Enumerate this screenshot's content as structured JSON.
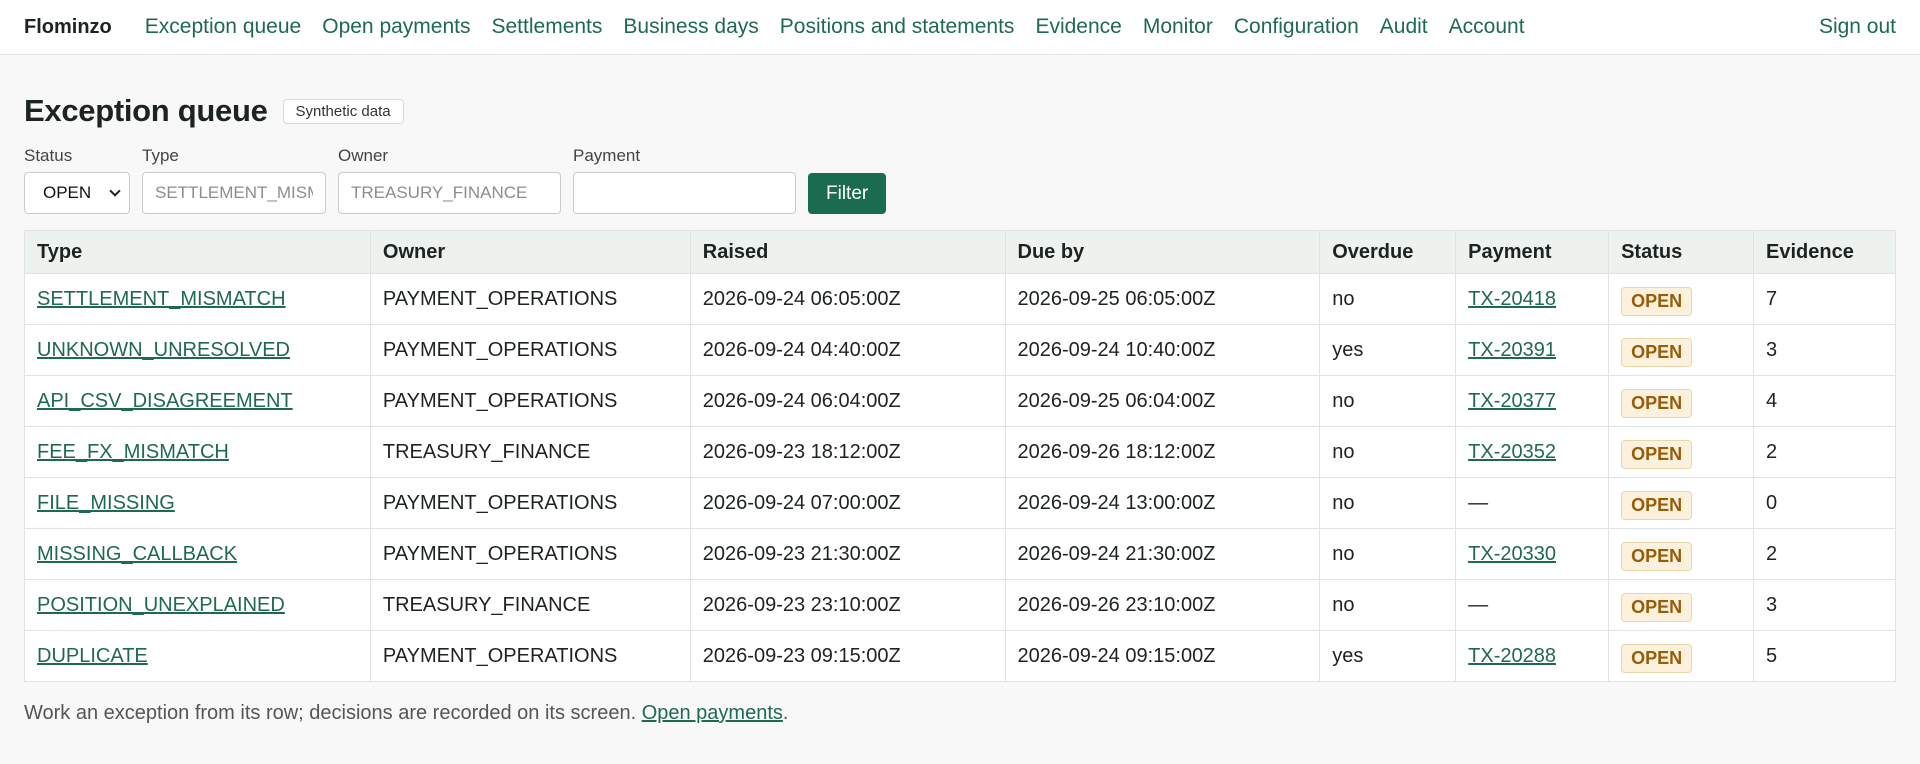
{
  "nav": {
    "brand": "Flominzo",
    "links": [
      "Exception queue",
      "Open payments",
      "Settlements",
      "Business days",
      "Positions and statements",
      "Evidence",
      "Monitor",
      "Configuration",
      "Audit",
      "Account"
    ],
    "sign_out": "Sign out"
  },
  "page": {
    "title": "Exception queue",
    "badge": "Synthetic data"
  },
  "filters": {
    "status_label": "Status",
    "status_value": "OPEN",
    "type_label": "Type",
    "type_placeholder": "SETTLEMENT_MISMATCH",
    "owner_label": "Owner",
    "owner_placeholder": "TREASURY_FINANCE",
    "payment_label": "Payment",
    "payment_placeholder": "",
    "filter_button": "Filter"
  },
  "table": {
    "headers": [
      "Type",
      "Owner",
      "Raised",
      "Due by",
      "Overdue",
      "Payment",
      "Status",
      "Evidence"
    ],
    "rows": [
      {
        "type": "SETTLEMENT_MISMATCH",
        "owner": "PAYMENT_OPERATIONS",
        "raised": "2026-09-24 06:05:00Z",
        "due": "2026-09-25 06:05:00Z",
        "overdue": "no",
        "payment": "TX-20418",
        "status": "OPEN",
        "evidence": "7"
      },
      {
        "type": "UNKNOWN_UNRESOLVED",
        "owner": "PAYMENT_OPERATIONS",
        "raised": "2026-09-24 04:40:00Z",
        "due": "2026-09-24 10:40:00Z",
        "overdue": "yes",
        "payment": "TX-20391",
        "status": "OPEN",
        "evidence": "3"
      },
      {
        "type": "API_CSV_DISAGREEMENT",
        "owner": "PAYMENT_OPERATIONS",
        "raised": "2026-09-24 06:04:00Z",
        "due": "2026-09-25 06:04:00Z",
        "overdue": "no",
        "payment": "TX-20377",
        "status": "OPEN",
        "evidence": "4"
      },
      {
        "type": "FEE_FX_MISMATCH",
        "owner": "TREASURY_FINANCE",
        "raised": "2026-09-23 18:12:00Z",
        "due": "2026-09-26 18:12:00Z",
        "overdue": "no",
        "payment": "TX-20352",
        "status": "OPEN",
        "evidence": "2"
      },
      {
        "type": "FILE_MISSING",
        "owner": "PAYMENT_OPERATIONS",
        "raised": "2026-09-24 07:00:00Z",
        "due": "2026-09-24 13:00:00Z",
        "overdue": "no",
        "payment": "—",
        "status": "OPEN",
        "evidence": "0"
      },
      {
        "type": "MISSING_CALLBACK",
        "owner": "PAYMENT_OPERATIONS",
        "raised": "2026-09-23 21:30:00Z",
        "due": "2026-09-24 21:30:00Z",
        "overdue": "no",
        "payment": "TX-20330",
        "status": "OPEN",
        "evidence": "2"
      },
      {
        "type": "POSITION_UNEXPLAINED",
        "owner": "TREASURY_FINANCE",
        "raised": "2026-09-23 23:10:00Z",
        "due": "2026-09-26 23:10:00Z",
        "overdue": "no",
        "payment": "—",
        "status": "OPEN",
        "evidence": "3"
      },
      {
        "type": "DUPLICATE",
        "owner": "PAYMENT_OPERATIONS",
        "raised": "2026-09-23 09:15:00Z",
        "due": "2026-09-24 09:15:00Z",
        "overdue": "yes",
        "payment": "TX-20288",
        "status": "OPEN",
        "evidence": "5"
      }
    ]
  },
  "footer": {
    "text": "Work an exception from its row; decisions are recorded on its screen.",
    "link": "Open payments",
    "trail": "."
  }
}
